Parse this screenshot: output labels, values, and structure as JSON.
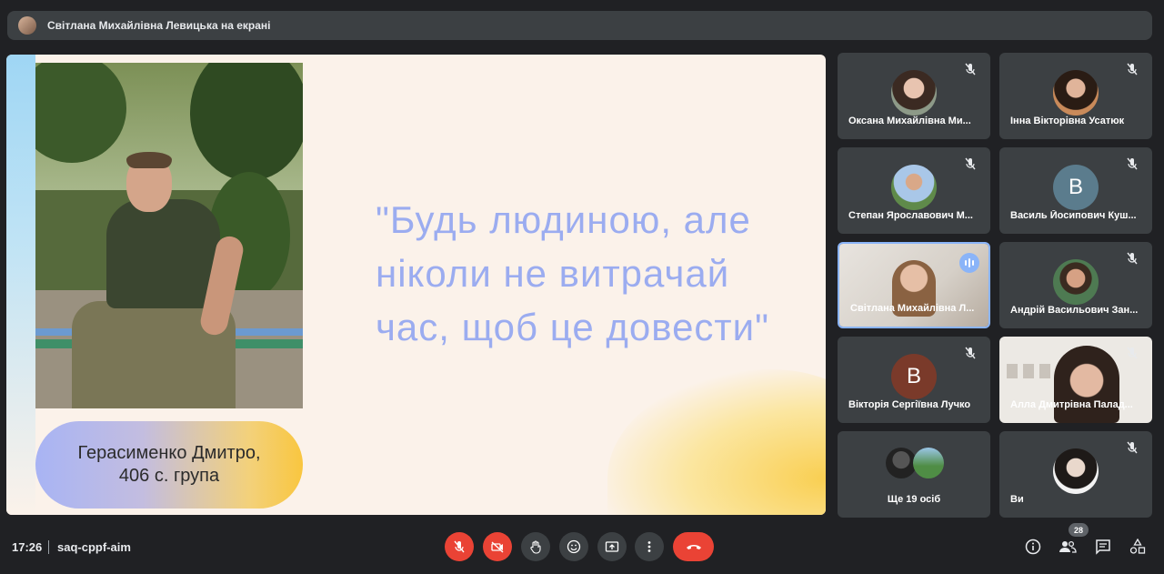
{
  "header": {
    "presenting_label": "Світлана Михайлівна Левицька на екрані"
  },
  "slide": {
    "name_line1": "Герасименко Дмитро,",
    "name_line2": "406 с. група",
    "quote_line1": "\"Будь людиною, але",
    "quote_line2": "ніколи не витрачай",
    "quote_line3": "час, щоб це довести\""
  },
  "participants": [
    {
      "name": "Оксана Михайлівна Ми...",
      "muted": true,
      "avatar": "photo"
    },
    {
      "name": "Інна Вікторівна Усатюк",
      "muted": true,
      "avatar": "photo"
    },
    {
      "name": "Степан Ярославович М...",
      "muted": true,
      "avatar": "photo"
    },
    {
      "name": "Василь Йосипович Куш...",
      "muted": true,
      "avatar": "letter",
      "letter": "В"
    },
    {
      "name": "Світлана Михайлівна Л...",
      "muted": false,
      "speaking": true,
      "avatar": "video"
    },
    {
      "name": "Андрій Васильович Зан...",
      "muted": true,
      "avatar": "photo"
    },
    {
      "name": "Вікторія Сергіївна Лучко",
      "muted": true,
      "avatar": "letter",
      "letter": "В"
    },
    {
      "name": "Алла Дмитрівна Палад...",
      "muted": true,
      "avatar": "video"
    },
    {
      "name": "Ще 19 осіб",
      "avatar": "group"
    },
    {
      "name": "Ви",
      "muted": true,
      "avatar": "photo"
    }
  ],
  "bottombar": {
    "time": "17:26",
    "meeting_code": "saq-cppf-aim",
    "participant_count": "28"
  },
  "colors": {
    "accent": "#8ab4f8",
    "danger": "#ea4335",
    "tile_bg": "#3c4043",
    "page_bg": "#202124"
  },
  "icons": {
    "mic_off": "mic-off-icon",
    "cam_off": "camera-off-icon",
    "raise_hand": "hand-icon",
    "emoji": "emoji-icon",
    "present": "present-icon",
    "more": "more-vert-icon",
    "end_call": "call-end-icon",
    "info": "info-icon",
    "people": "people-icon",
    "chat": "chat-icon",
    "activities": "activities-icon"
  }
}
